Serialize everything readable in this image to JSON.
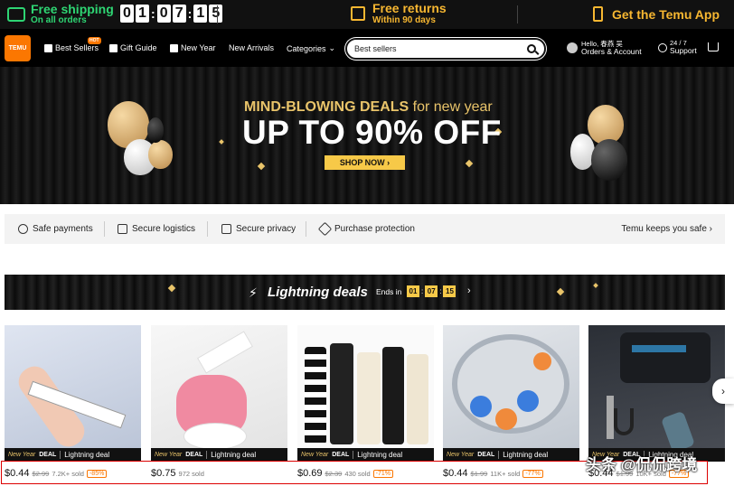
{
  "topbar": {
    "shipping_title": "Free shipping",
    "shipping_sub": "On all orders",
    "countdown": [
      "0",
      "1",
      "0",
      "7",
      "1",
      "5"
    ],
    "returns_title": "Free returns",
    "returns_sub": "Within 90 days",
    "app_label": "Get the Temu App"
  },
  "nav": {
    "logo": "TEMU",
    "items": [
      "Best Sellers",
      "Gift Guide",
      "New Year",
      "New Arrivals",
      "Categories"
    ],
    "hot_badge": "HOT",
    "search_placeholder": "Best sellers",
    "account_line1": "Hello, 春燕 吴",
    "account_line2": "Orders & Account",
    "support_line1": "24 / 7",
    "support_line2": "Support"
  },
  "hero": {
    "subtitle_bold": "MIND-BLOWING DEALS",
    "subtitle_rest": " for new year",
    "headline": "UP TO 90% OFF",
    "cta": "SHOP NOW"
  },
  "trust": {
    "items": [
      "Safe payments",
      "Secure logistics",
      "Secure privacy",
      "Purchase protection"
    ],
    "right": "Temu keeps you safe"
  },
  "lightning": {
    "title": "Lightning deals",
    "ends_in": "Ends in",
    "timer": [
      "01",
      "07",
      "15"
    ]
  },
  "deal_tag": {
    "new_year": "New Year",
    "deal": "DEAL",
    "label": "Lightning deal"
  },
  "products": [
    {
      "price": "$0.44",
      "old": "$2.99",
      "sold": "7.2K+ sold",
      "disc": "-85%"
    },
    {
      "price": "$0.75",
      "old": "",
      "sold": "972 sold",
      "disc": ""
    },
    {
      "price": "$0.69",
      "old": "$2.39",
      "sold": "430 sold",
      "disc": "-71%"
    },
    {
      "price": "$0.44",
      "old": "$1.99",
      "sold": "11K+ sold",
      "disc": "-77%"
    },
    {
      "price": "$0.44",
      "old": "$1.99",
      "sold": "10K+ sold",
      "disc": "-77%"
    }
  ],
  "watermark": "头条 @侃侃跨境",
  "colors": {
    "accent": "#fb7701",
    "gold": "#f7c948",
    "green": "#2ed573",
    "highlight": "#dd0000"
  }
}
